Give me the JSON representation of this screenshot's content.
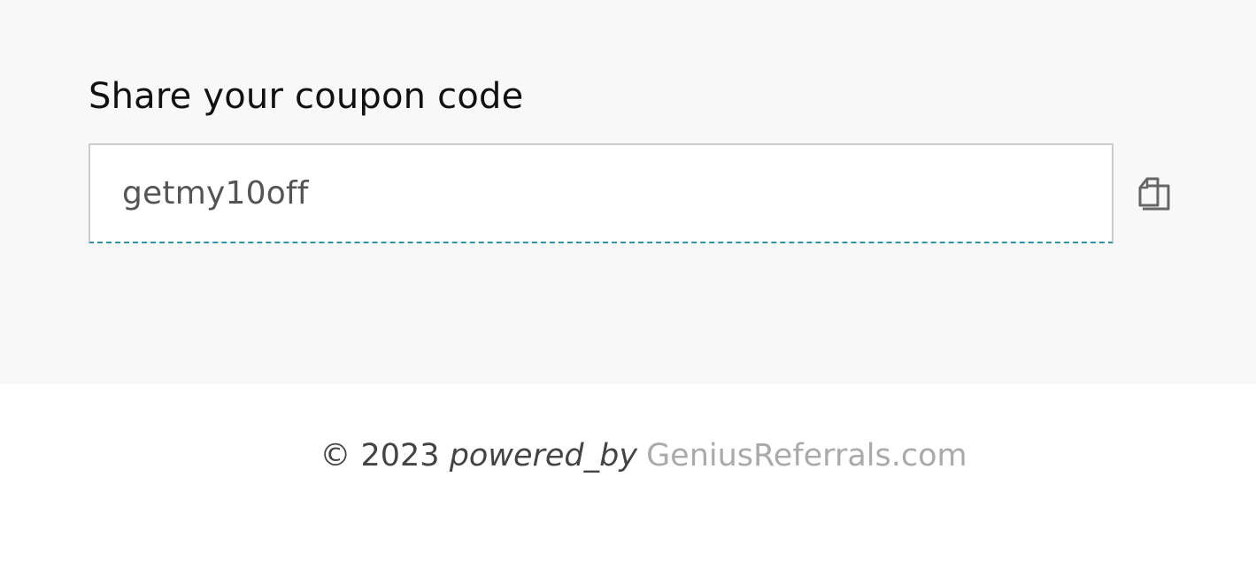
{
  "share": {
    "title": "Share your coupon code",
    "coupon_code": "getmy10off",
    "copy_icon": "copy-icon"
  },
  "footer": {
    "copyright": "© 2023",
    "powered_by": "powered_by",
    "link_text": "GeniusReferrals.com"
  },
  "colors": {
    "panel_background": "#f8f8f8",
    "input_border": "#cccccc",
    "accent_dashed_underline": "#2a96a8",
    "link_color": "#aaaaaa"
  }
}
